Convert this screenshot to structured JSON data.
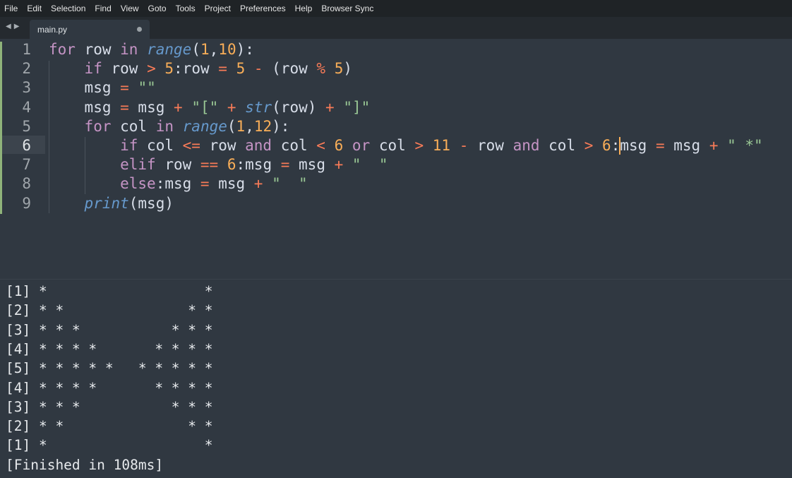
{
  "menubar": {
    "items": [
      "File",
      "Edit",
      "Selection",
      "Find",
      "View",
      "Goto",
      "Tools",
      "Project",
      "Preferences",
      "Help",
      "Browser Sync"
    ]
  },
  "tabs": [
    {
      "label": "main.py",
      "modified": true
    }
  ],
  "editor": {
    "current_line": 6,
    "line_numbers": [
      "1",
      "2",
      "3",
      "4",
      "5",
      "6",
      "7",
      "8",
      "9"
    ],
    "lines": [
      [
        [
          "kw",
          "for"
        ],
        [
          "pl",
          " row "
        ],
        [
          "kw",
          "in"
        ],
        [
          "pl",
          " "
        ],
        [
          "fn",
          "range"
        ],
        [
          "pl",
          "("
        ],
        [
          "num",
          "1"
        ],
        [
          "pl",
          ","
        ],
        [
          "num",
          "10"
        ],
        [
          "pl",
          "):"
        ]
      ],
      [
        [
          "kw",
          "if"
        ],
        [
          "pl",
          " row "
        ],
        [
          "op",
          ">"
        ],
        [
          "pl",
          " "
        ],
        [
          "num",
          "5"
        ],
        [
          "pl",
          ":row "
        ],
        [
          "op",
          "="
        ],
        [
          "pl",
          " "
        ],
        [
          "num",
          "5"
        ],
        [
          "pl",
          " "
        ],
        [
          "op",
          "-"
        ],
        [
          "pl",
          " (row "
        ],
        [
          "op",
          "%"
        ],
        [
          "pl",
          " "
        ],
        [
          "num",
          "5"
        ],
        [
          "pl",
          ")"
        ]
      ],
      [
        [
          "pl",
          "msg "
        ],
        [
          "op",
          "="
        ],
        [
          "pl",
          " "
        ],
        [
          "str",
          "\"\""
        ]
      ],
      [
        [
          "pl",
          "msg "
        ],
        [
          "op",
          "="
        ],
        [
          "pl",
          " msg "
        ],
        [
          "op",
          "+"
        ],
        [
          "pl",
          " "
        ],
        [
          "str",
          "\"[\""
        ],
        [
          "pl",
          " "
        ],
        [
          "op",
          "+"
        ],
        [
          "pl",
          " "
        ],
        [
          "fn",
          "str"
        ],
        [
          "pl",
          "(row) "
        ],
        [
          "op",
          "+"
        ],
        [
          "pl",
          " "
        ],
        [
          "str",
          "\"]\""
        ]
      ],
      [
        [
          "kw",
          "for"
        ],
        [
          "pl",
          " col "
        ],
        [
          "kw",
          "in"
        ],
        [
          "pl",
          " "
        ],
        [
          "fn",
          "range"
        ],
        [
          "pl",
          "("
        ],
        [
          "num",
          "1"
        ],
        [
          "pl",
          ","
        ],
        [
          "num",
          "12"
        ],
        [
          "pl",
          "):"
        ]
      ],
      [
        [
          "kw",
          "if"
        ],
        [
          "pl",
          " col "
        ],
        [
          "op",
          "<="
        ],
        [
          "pl",
          " row "
        ],
        [
          "kw",
          "and"
        ],
        [
          "pl",
          " col "
        ],
        [
          "op",
          "<"
        ],
        [
          "pl",
          " "
        ],
        [
          "num",
          "6"
        ],
        [
          "pl",
          " "
        ],
        [
          "kw",
          "or"
        ],
        [
          "pl",
          " col "
        ],
        [
          "op",
          ">"
        ],
        [
          "pl",
          " "
        ],
        [
          "num",
          "11"
        ],
        [
          "pl",
          " "
        ],
        [
          "op",
          "-"
        ],
        [
          "pl",
          " row "
        ],
        [
          "kw",
          "and"
        ],
        [
          "pl",
          " col "
        ],
        [
          "op",
          ">"
        ],
        [
          "pl",
          " "
        ],
        [
          "num",
          "6"
        ],
        [
          "pl",
          ":"
        ],
        [
          "caret",
          ""
        ],
        [
          "pl",
          "msg "
        ],
        [
          "op",
          "="
        ],
        [
          "pl",
          " msg "
        ],
        [
          "op",
          "+"
        ],
        [
          "pl",
          " "
        ],
        [
          "str",
          "\" *\""
        ]
      ],
      [
        [
          "kw",
          "elif"
        ],
        [
          "pl",
          " row "
        ],
        [
          "op",
          "=="
        ],
        [
          "pl",
          " "
        ],
        [
          "num",
          "6"
        ],
        [
          "pl",
          ":msg "
        ],
        [
          "op",
          "="
        ],
        [
          "pl",
          " msg "
        ],
        [
          "op",
          "+"
        ],
        [
          "pl",
          " "
        ],
        [
          "str",
          "\"  \""
        ]
      ],
      [
        [
          "kw",
          "else"
        ],
        [
          "pl",
          ":msg "
        ],
        [
          "op",
          "="
        ],
        [
          "pl",
          " msg "
        ],
        [
          "op",
          "+"
        ],
        [
          "pl",
          " "
        ],
        [
          "str",
          "\"  \""
        ]
      ],
      [
        [
          "fn",
          "print"
        ],
        [
          "pl",
          "(msg)"
        ]
      ]
    ]
  },
  "output": {
    "lines": [
      "[1] *                   *",
      "[2] * *               * *",
      "[3] * * *           * * *",
      "[4] * * * *       * * * *",
      "[5] * * * * *   * * * * *",
      "[4] * * * *       * * * *",
      "[3] * * *           * * *",
      "[2] * *               * *",
      "[1] *                   *",
      "[Finished in 108ms]"
    ]
  }
}
